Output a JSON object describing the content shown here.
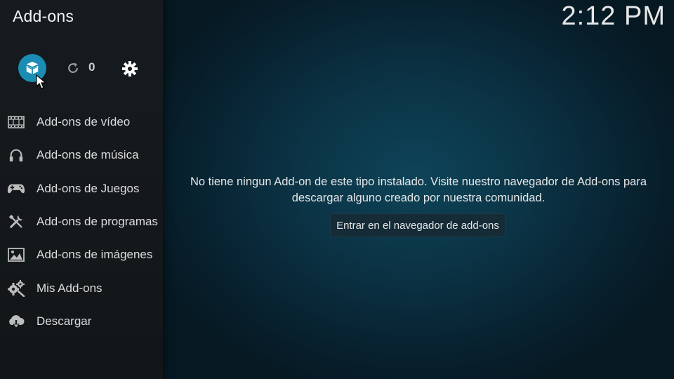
{
  "header": {
    "title": "Add-ons",
    "clock": "2:12 PM"
  },
  "toolbar": {
    "browser_icon": "open-box-icon",
    "refresh_icon": "refresh-icon",
    "update_count": "0",
    "settings_icon": "gear-icon"
  },
  "sidebar": {
    "items": [
      {
        "label": "Add-ons de vídeo",
        "icon": "film-icon"
      },
      {
        "label": "Add-ons de música",
        "icon": "headphones-icon"
      },
      {
        "label": "Add-ons de Juegos",
        "icon": "gamepad-icon"
      },
      {
        "label": "Add-ons de programas",
        "icon": "tools-icon"
      },
      {
        "label": "Add-ons de imágenes",
        "icon": "picture-icon"
      },
      {
        "label": "Mis Add-ons",
        "icon": "gears-icon"
      },
      {
        "label": "Descargar",
        "icon": "cloud-download-icon"
      }
    ]
  },
  "main": {
    "message_line1": "No tiene ningun Add-on de este tipo instalado. Visite nuestro navegador de Add-ons para",
    "message_line2": "descargar alguno creado por nuestra comunidad.",
    "button_label": "Entrar en el navegador de add-ons"
  },
  "colors": {
    "accent": "#1b8cb3",
    "sidebar_bg": "#161b1f",
    "main_bg": "#0b3446"
  }
}
